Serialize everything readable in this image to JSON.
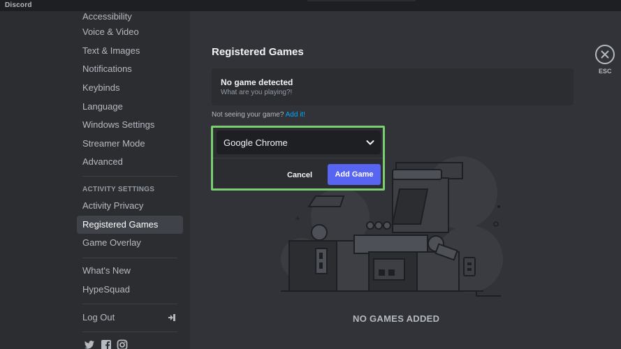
{
  "app": {
    "name": "Discord"
  },
  "sidebar": {
    "items_top": [
      {
        "label": "Accessibility"
      },
      {
        "label": "Voice & Video"
      },
      {
        "label": "Text & Images"
      },
      {
        "label": "Notifications"
      },
      {
        "label": "Keybinds"
      },
      {
        "label": "Language"
      },
      {
        "label": "Windows Settings"
      },
      {
        "label": "Streamer Mode"
      },
      {
        "label": "Advanced"
      }
    ],
    "activity_header": "ACTIVITY SETTINGS",
    "activity_items": [
      {
        "label": "Activity Privacy"
      },
      {
        "label": "Registered Games",
        "active": true
      },
      {
        "label": "Game Overlay"
      }
    ],
    "misc_items": [
      {
        "label": "What's New"
      },
      {
        "label": "HypeSquad"
      }
    ],
    "logout_label": "Log Out",
    "social_icons": [
      "twitter-icon",
      "facebook-icon",
      "instagram-icon"
    ]
  },
  "main": {
    "title": "Registered Games",
    "detect": {
      "title": "No game detected",
      "subtitle": "What are you playing?!"
    },
    "not_seeing_text": "Not seeing your game?",
    "add_it_link": "Add it!",
    "selected_game": "Google Chrome",
    "cancel_label": "Cancel",
    "add_game_label": "Add Game",
    "empty_label": "NO GAMES ADDED"
  },
  "close": {
    "label": "ESC",
    "icon": "close-icon"
  },
  "colors": {
    "background": "#313338",
    "sidebar": "#2b2d31",
    "accent": "#5865f2",
    "link": "#00a8fc",
    "highlight": "#7ccf70"
  }
}
